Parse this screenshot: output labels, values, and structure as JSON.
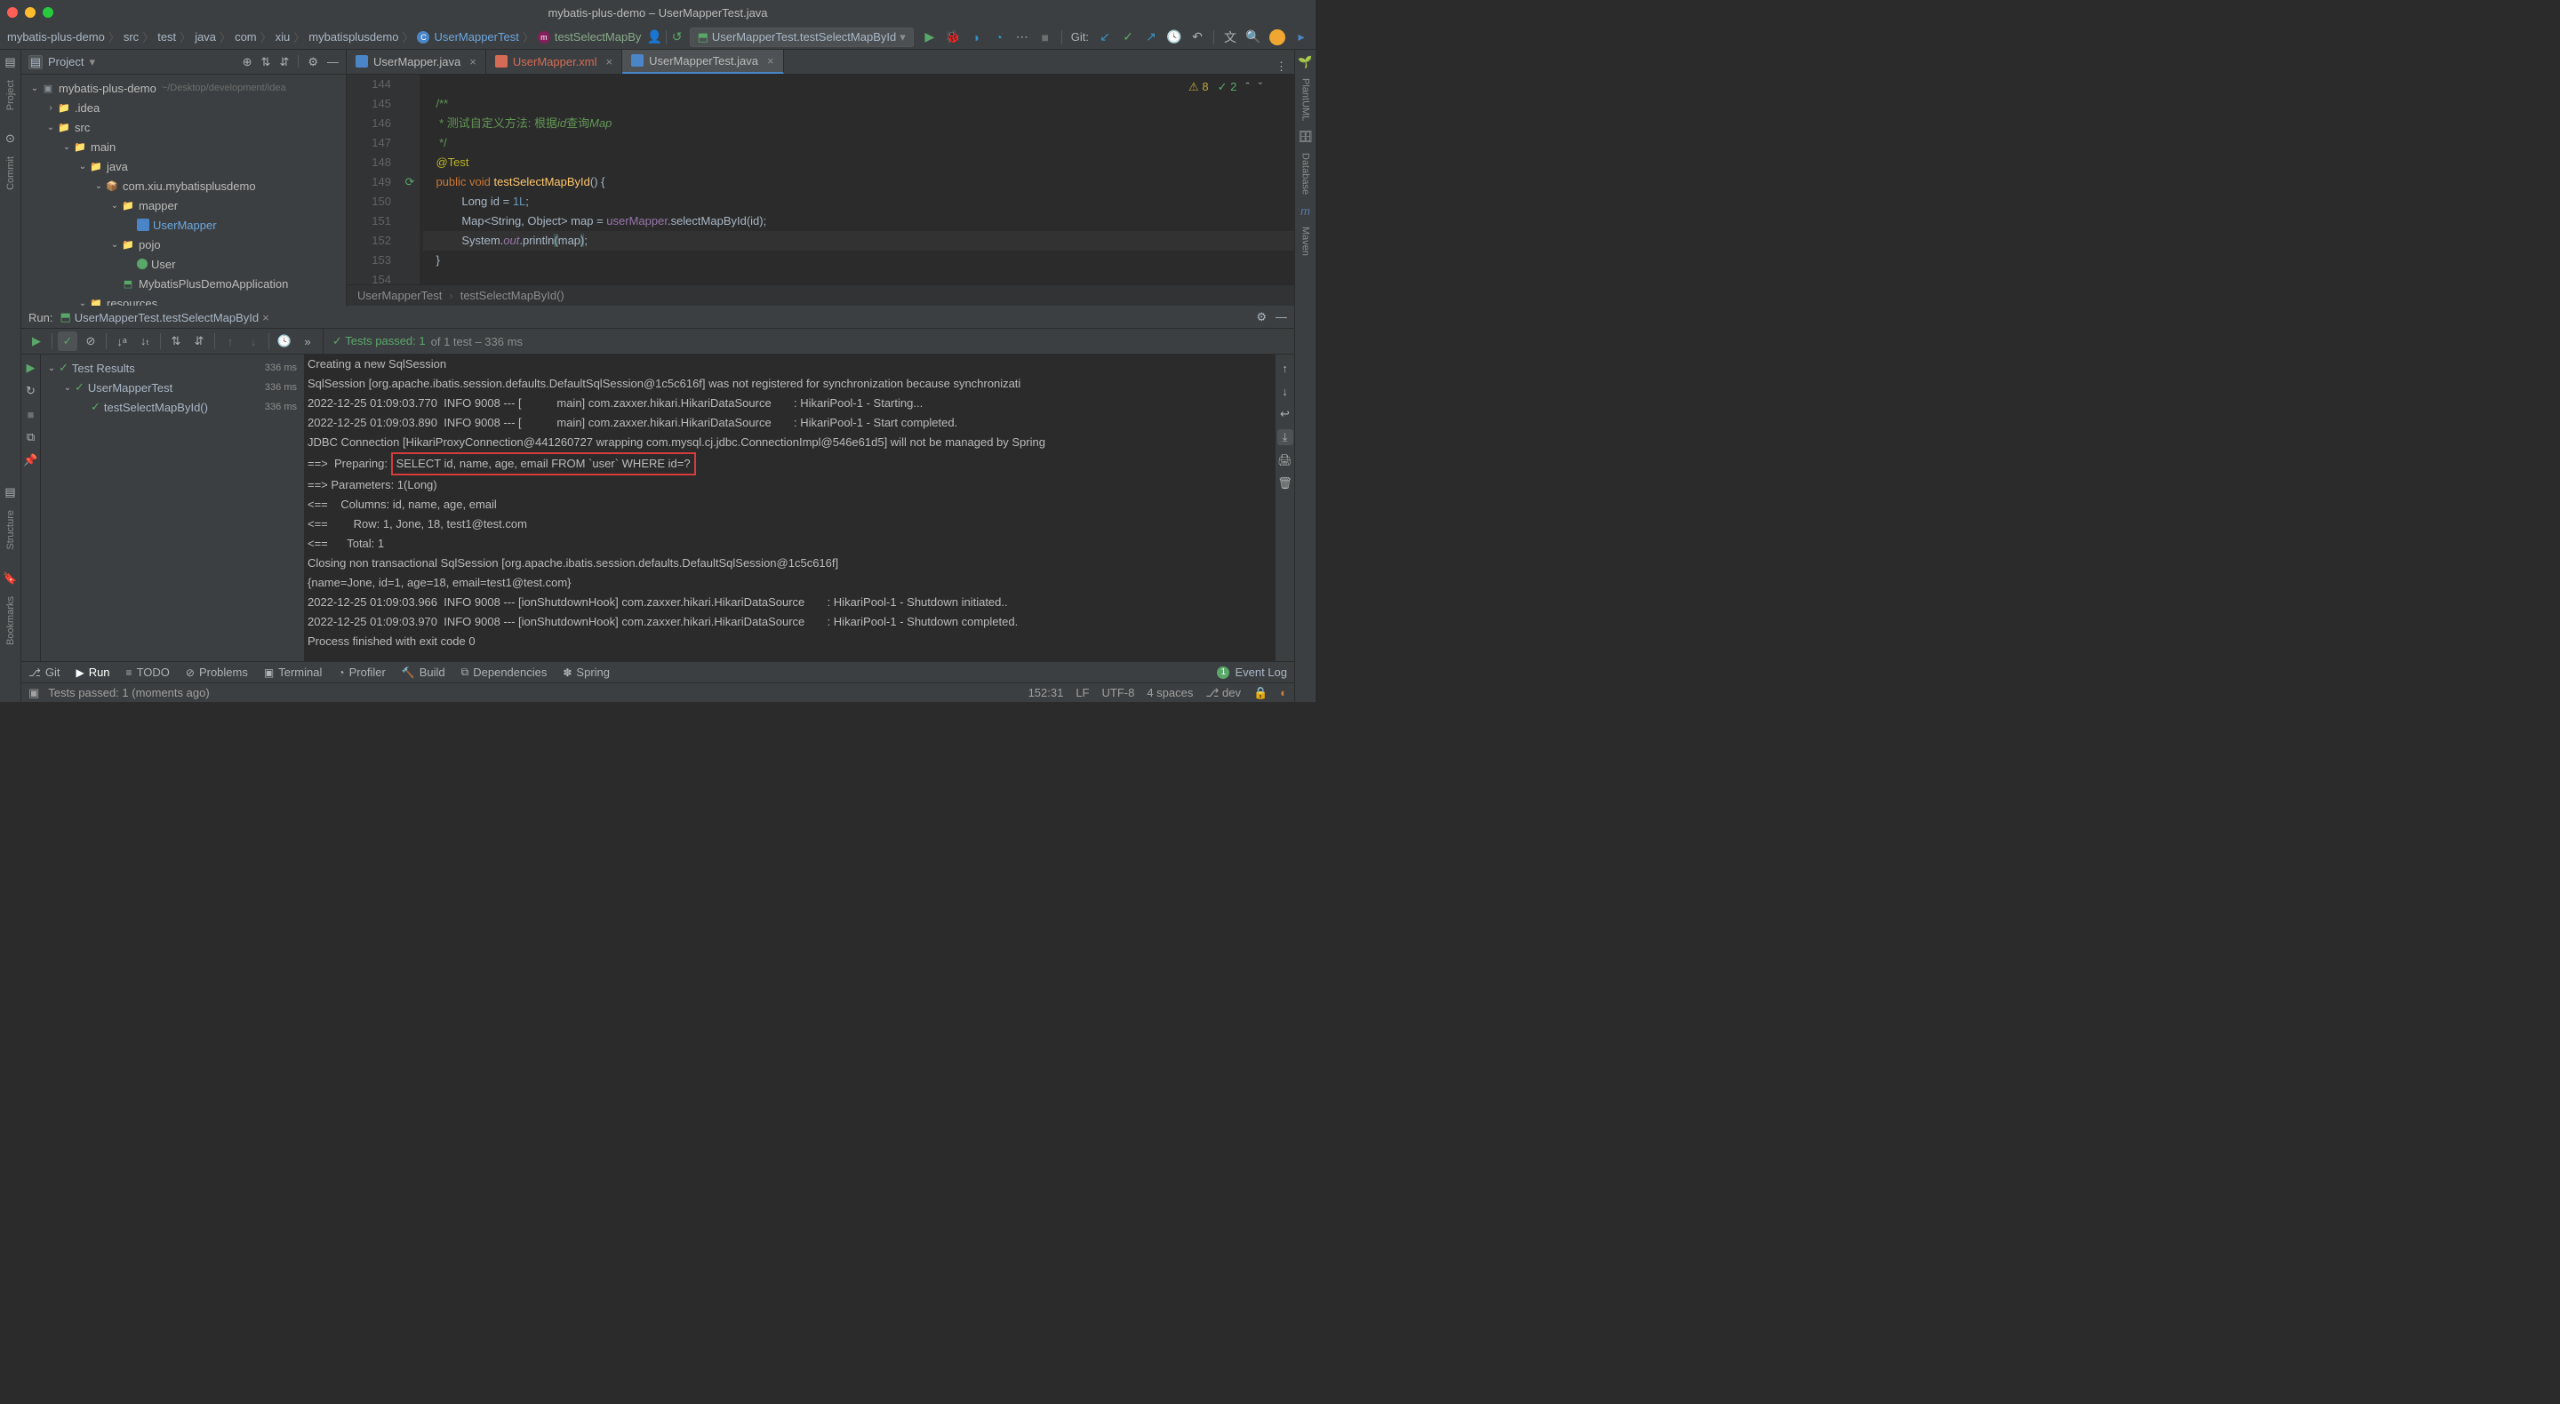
{
  "title": "mybatis-plus-demo – UserMapperTest.java",
  "breadcrumb": [
    "mybatis-plus-demo",
    "src",
    "test",
    "java",
    "com",
    "xiu",
    "mybatisplusdemo"
  ],
  "breadcrumb_class": "UserMapperTest",
  "breadcrumb_method": "testSelectMapBy",
  "run_config": "UserMapperTest.testSelectMapById",
  "git_label": "Git:",
  "proj_title": "Project",
  "tree": {
    "root": "mybatis-plus-demo",
    "root_hint": "~/Desktop/development/idea",
    "idea": ".idea",
    "src": "src",
    "main": "main",
    "java": "java",
    "pkg": "com.xiu.mybatisplusdemo",
    "mapper": "mapper",
    "usermapper": "UserMapper",
    "pojo": "pojo",
    "user": "User",
    "app": "MybatisPlusDemoApplication",
    "resources": "resources"
  },
  "tabs": [
    {
      "name": "UserMapper.java",
      "active": false,
      "color": "#4a86c7"
    },
    {
      "name": "UserMapper.xml",
      "active": false,
      "color": "#d66b55"
    },
    {
      "name": "UserMapperTest.java",
      "active": true,
      "color": "#4a86c7"
    }
  ],
  "badges": {
    "warn": "8",
    "ok": "2"
  },
  "code": {
    "lines": [
      {
        "n": "144",
        "html": ""
      },
      {
        "n": "145",
        "html": "<span class='cc-jd'>/**</span>"
      },
      {
        "n": "146",
        "html": "<span class='cc-jd'> * 测试自定义方法: 根据</span><span class='cc-tag'>id</span><span class='cc-jd'>查询</span><span class='cc-tag'>Map</span>"
      },
      {
        "n": "147",
        "html": "<span class='cc-jd'> */</span>"
      },
      {
        "n": "148",
        "html": "<span class='cc-anno'>@Test</span>"
      },
      {
        "n": "149",
        "html": "<span class='cc-kw'>public void</span> <span class='cc-method'>testSelectMapById</span>() {"
      },
      {
        "n": "150",
        "html": "    Long id = <span class='cc-num'>1L</span>;"
      },
      {
        "n": "151",
        "html": "    Map&lt;String, Object&gt; map = <span class='cc-field'>userMapper</span>.selectMapById(id);"
      },
      {
        "n": "152",
        "html": "    System.<span class='cc-static'>out</span>.println<span class='cc-paren-hl'>(</span>map<span class='cc-paren-hl'>)</span>;",
        "hl": true
      },
      {
        "n": "153",
        "html": "}"
      },
      {
        "n": "154",
        "html": ""
      }
    ]
  },
  "crumb2": [
    "UserMapperTest",
    "testSelectMapById()"
  ],
  "run": {
    "label": "Run:",
    "tab": "UserMapperTest.testSelectMapById",
    "status_pass": "Tests passed: 1",
    "status_rest": " of 1 test – 336 ms",
    "tree": [
      {
        "lvl": 0,
        "name": "Test Results",
        "time": "336 ms",
        "chev": true
      },
      {
        "lvl": 1,
        "name": "UserMapperTest",
        "time": "336 ms",
        "chev": true
      },
      {
        "lvl": 2,
        "name": "testSelectMapById()",
        "time": "336 ms",
        "chev": false
      }
    ],
    "console": [
      "Creating a new SqlSession",
      "SqlSession [org.apache.ibatis.session.defaults.DefaultSqlSession@1c5c616f] was not registered for synchronization because synchronizati",
      "2022-12-25 01:09:03.770  INFO 9008 --- [           main] com.zaxxer.hikari.HikariDataSource       : HikariPool-1 - Starting...",
      "2022-12-25 01:09:03.890  INFO 9008 --- [           main] com.zaxxer.hikari.HikariDataSource       : HikariPool-1 - Start completed.",
      "JDBC Connection [HikariProxyConnection@441260727 wrapping com.mysql.cj.jdbc.ConnectionImpl@546e61d5] will not be managed by Spring",
      {
        "pre": "==>  Preparing: ",
        "box": "SELECT id, name, age, email FROM `user` WHERE id=?"
      },
      "==> Parameters: 1(Long)",
      "<==    Columns: id, name, age, email",
      "<==        Row: 1, Jone, 18, test1@test.com",
      "<==      Total: 1",
      "Closing non transactional SqlSession [org.apache.ibatis.session.defaults.DefaultSqlSession@1c5c616f]",
      "{name=Jone, id=1, age=18, email=test1@test.com}",
      "2022-12-25 01:09:03.966  INFO 9008 --- [ionShutdownHook] com.zaxxer.hikari.HikariDataSource       : HikariPool-1 - Shutdown initiated..",
      "2022-12-25 01:09:03.970  INFO 9008 --- [ionShutdownHook] com.zaxxer.hikari.HikariDataSource       : HikariPool-1 - Shutdown completed.",
      "",
      "Process finished with exit code 0"
    ]
  },
  "toolwins": [
    {
      "name": "Git",
      "ic": "⎇"
    },
    {
      "name": "Run",
      "ic": "▶",
      "active": true
    },
    {
      "name": "TODO",
      "ic": "≡"
    },
    {
      "name": "Problems",
      "ic": "⊘"
    },
    {
      "name": "Terminal",
      "ic": "▣"
    },
    {
      "name": "Profiler",
      "ic": "◔"
    },
    {
      "name": "Build",
      "ic": "🔨"
    },
    {
      "name": "Dependencies",
      "ic": "⧉"
    },
    {
      "name": "Spring",
      "ic": "✽"
    }
  ],
  "eventlog": "Event Log",
  "status": {
    "msg": "Tests passed: 1 (moments ago)",
    "pos": "152:31",
    "lf": "LF",
    "enc": "UTF-8",
    "indent": "4 spaces",
    "branch": "dev"
  },
  "rails": {
    "left": [
      "Project",
      "Commit",
      "Structure",
      "Bookmarks"
    ],
    "right": [
      "PlantUML",
      "Database",
      "Maven"
    ]
  }
}
